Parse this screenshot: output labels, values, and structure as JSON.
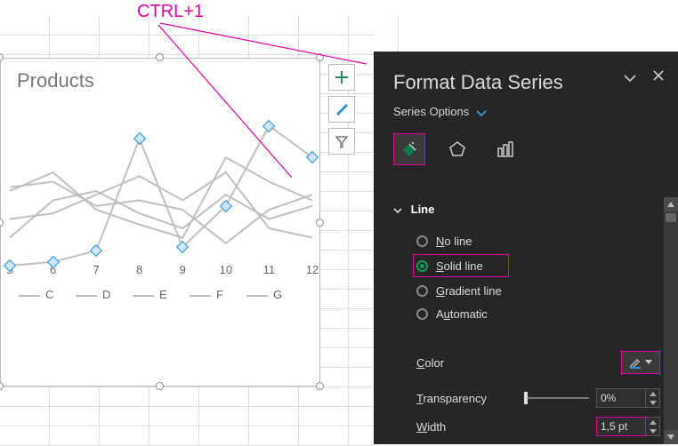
{
  "annotation": {
    "shortcut": "CTRL+1"
  },
  "chart": {
    "title": "Products",
    "x_ticks": [
      "5",
      "6",
      "7",
      "8",
      "9",
      "10",
      "11",
      "12"
    ],
    "legend": [
      "C",
      "D",
      "E",
      "F",
      "G"
    ],
    "selected_series": "G",
    "selected_points_index": [
      0,
      1,
      2,
      3,
      4,
      5,
      6,
      7
    ]
  },
  "chart_element_buttons": {
    "plus": "add-chart-element",
    "brush": "chart-styles",
    "funnel": "chart-filters"
  },
  "pane": {
    "title": "Format Data Series",
    "series_options_label": "Series Options",
    "tabs": {
      "fill_line": "Fill & Line",
      "effects": "Effects",
      "series_options": "Series Options"
    },
    "section": {
      "line_header": "Line"
    },
    "line_type": {
      "options": {
        "no_line": "No line",
        "solid_line": "Solid line",
        "gradient_line": "Gradient line",
        "automatic": "Automatic"
      },
      "selected": "solid_line"
    },
    "color_label": "Color",
    "transparency_label": "Transparency",
    "transparency_value": "0%",
    "width_label": "Width",
    "width_value": "1,5 pt"
  },
  "chart_data": {
    "type": "line",
    "title": "Products",
    "xlabel": "",
    "ylabel": "",
    "categories": [
      5,
      6,
      7,
      8,
      9,
      10,
      11,
      12
    ],
    "ylim": [
      0,
      100
    ],
    "series": [
      {
        "name": "C",
        "values": [
          60,
          70,
          50,
          42,
          35,
          78,
          65,
          55
        ]
      },
      {
        "name": "D",
        "values": [
          35,
          55,
          60,
          48,
          40,
          58,
          45,
          52
        ]
      },
      {
        "name": "E",
        "values": [
          45,
          48,
          58,
          68,
          55,
          70,
          40,
          35
        ]
      },
      {
        "name": "F",
        "values": [
          62,
          65,
          52,
          55,
          50,
          32,
          50,
          58
        ]
      },
      {
        "name": "G",
        "values": [
          20,
          22,
          28,
          88,
          30,
          52,
          95,
          78
        ]
      }
    ]
  }
}
